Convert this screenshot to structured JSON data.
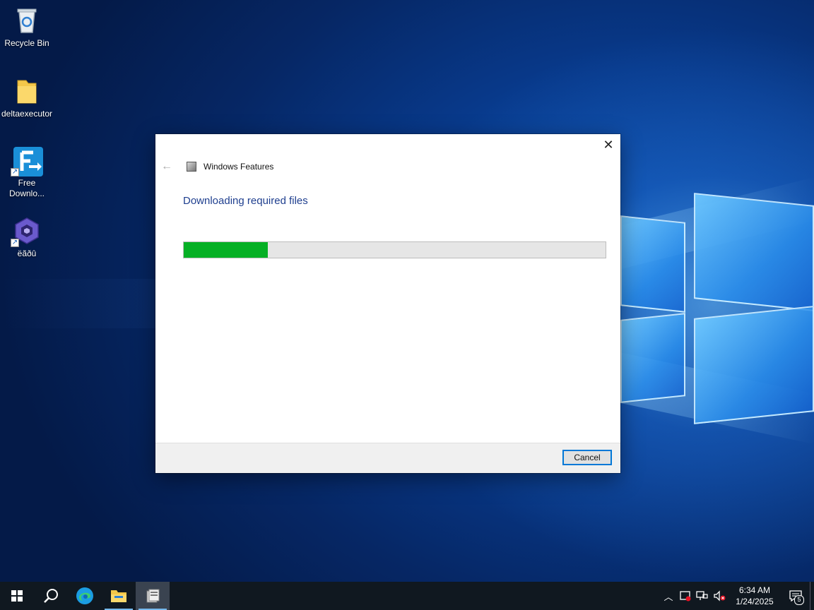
{
  "desktop": {
    "icons": [
      {
        "label": "Recycle Bin",
        "icon": "recycle-bin-icon"
      },
      {
        "label": "deltaexecutor",
        "icon": "folder-icon"
      },
      {
        "label": "Free Downlo...",
        "icon": "free-download-manager-icon",
        "shortcut": true
      },
      {
        "label": "ëãðû",
        "icon": "gamecube-icon",
        "shortcut": true
      }
    ]
  },
  "dialog": {
    "title": "Windows Features",
    "heading": "Downloading required files",
    "progress_fraction": 0.2,
    "progress_color": "#06b025",
    "cancel_label": "Cancel",
    "close_glyph": "✕",
    "back_glyph": "←"
  },
  "taskbar": {
    "pinned": [
      "windows-start-icon",
      "search-icon",
      "edge-icon",
      "file-explorer-icon",
      "windows-features-icon"
    ],
    "active": "windows-features-icon",
    "clock": {
      "time": "6:34 AM",
      "date": "1/24/2025"
    },
    "notification_count": "5"
  },
  "colors": {
    "accent": "#0078d7",
    "heading": "#1f3f8f",
    "taskbar": "#101820"
  }
}
